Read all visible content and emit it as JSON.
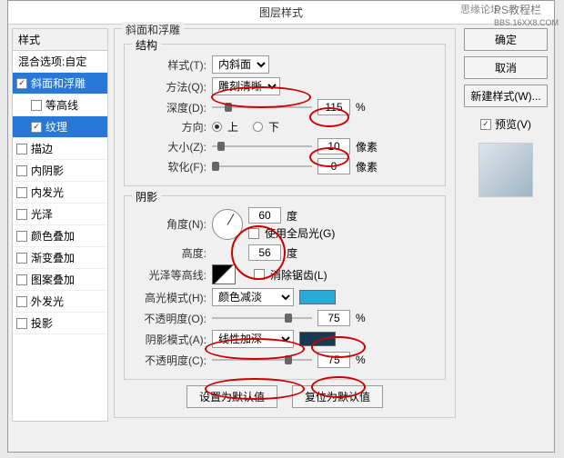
{
  "watermark_left": "思缘论坛",
  "watermark_right": "PS教程栏",
  "watermark_url": "BBS.16XX8.COM",
  "dialog": {
    "title": "图层样式"
  },
  "left": {
    "header": "样式",
    "blend": "混合选项:自定",
    "bevel": "斜面和浮雕",
    "contour": "等高线",
    "texture": "纹理",
    "stroke": "描边",
    "innerShadow": "内阴影",
    "innerGlow": "内发光",
    "satin": "光泽",
    "colorOverlay": "颜色叠加",
    "gradOverlay": "渐变叠加",
    "patternOverlay": "图案叠加",
    "outerGlow": "外发光",
    "dropShadow": "投影"
  },
  "mid": {
    "mainTitle": "斜面和浮雕",
    "structTitle": "结构",
    "styleLabel": "样式(T):",
    "styleValue": "内斜面",
    "techLabel": "方法(Q):",
    "techValue": "雕刻清晰",
    "depthLabel": "深度(D):",
    "depthValue": "115",
    "pct": "%",
    "dirLabel": "方向:",
    "dirUp": "上",
    "dirDown": "下",
    "sizeLabel": "大小(Z):",
    "sizeValue": "10",
    "px": "像素",
    "softenLabel": "软化(F):",
    "softenValue": "0",
    "shadeTitle": "阴影",
    "angleLabel": "角度(N):",
    "angleValue": "60",
    "deg": "度",
    "globalLabel": "使用全局光(G)",
    "altLabel": "高度:",
    "altValue": "56",
    "glossLabel": "光泽等高线:",
    "antiLabel": "消除锯齿(L)",
    "hlModeLabel": "高光模式(H):",
    "hlModeValue": "颜色减淡",
    "hlOpacityLabel": "不透明度(O):",
    "hlOpacityValue": "75",
    "shModeLabel": "阴影模式(A):",
    "shModeValue": "线性加深",
    "shOpacityLabel": "不透明度(C):",
    "shOpacityValue": "75",
    "setDefault": "设置为默认值",
    "resetDefault": "复位为默认值",
    "hlColor": "#2aa9d8",
    "shColor": "#163a52"
  },
  "right": {
    "ok": "确定",
    "cancel": "取消",
    "newStyle": "新建样式(W)...",
    "preview": "预览(V)"
  }
}
